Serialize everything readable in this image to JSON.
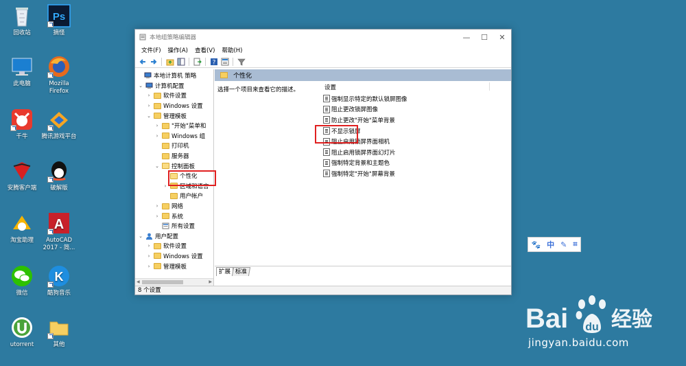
{
  "desktop": {
    "icons": [
      {
        "label": "回收站",
        "icon": "recycle-bin-icon"
      },
      {
        "label": "摘怪",
        "icon": "photoshop-icon"
      },
      {
        "label": "此电脑",
        "icon": "computer-icon"
      },
      {
        "label": "Mozilla Firefox",
        "icon": "firefox-icon"
      },
      {
        "label": "千牛",
        "icon": "qianniu-icon"
      },
      {
        "label": "腾讯游戏平台",
        "icon": "tencent-game-icon"
      },
      {
        "label": "安腾客户端",
        "icon": "antivirus-icon"
      },
      {
        "label": "破解版",
        "icon": "qq-icon"
      },
      {
        "label": "淘宝助理",
        "icon": "taobao-helper-icon"
      },
      {
        "label": "AutoCAD 2017 - 简...",
        "icon": "autocad-icon"
      },
      {
        "label": "微信",
        "icon": "wechat-icon"
      },
      {
        "label": "酷狗音乐",
        "icon": "kugou-icon"
      },
      {
        "label": "utorrent",
        "icon": "utorrent-icon"
      },
      {
        "label": "其他",
        "icon": "folder-icon"
      }
    ]
  },
  "window": {
    "title": "本地组策略编辑器",
    "menu": [
      "文件(F)",
      "操作(A)",
      "查看(V)",
      "帮助(H)"
    ],
    "tree": [
      {
        "label": "本地计算机 策略",
        "level": 0,
        "exp": "",
        "icon": "computer"
      },
      {
        "label": "计算机配置",
        "level": 1,
        "exp": "⌄",
        "icon": "computer"
      },
      {
        "label": "软件设置",
        "level": 2,
        "exp": "›",
        "icon": "folder"
      },
      {
        "label": "Windows 设置",
        "level": 2,
        "exp": "›",
        "icon": "folder"
      },
      {
        "label": "管理模板",
        "level": 2,
        "exp": "⌄",
        "icon": "folder"
      },
      {
        "label": "\"开始\"菜单和",
        "level": 3,
        "exp": "›",
        "icon": "folder"
      },
      {
        "label": "Windows 组",
        "level": 3,
        "exp": "›",
        "icon": "folder"
      },
      {
        "label": "打印机",
        "level": 3,
        "exp": "",
        "icon": "folder"
      },
      {
        "label": "服务器",
        "level": 3,
        "exp": "",
        "icon": "folder"
      },
      {
        "label": "控制面板",
        "level": 3,
        "exp": "⌄",
        "icon": "folder-open"
      },
      {
        "label": "个性化",
        "level": 4,
        "exp": "",
        "icon": "folder-open"
      },
      {
        "label": "区域和语言",
        "level": 4,
        "exp": "›",
        "icon": "folder"
      },
      {
        "label": "用户帐户",
        "level": 4,
        "exp": "",
        "icon": "folder"
      },
      {
        "label": "网络",
        "level": 3,
        "exp": "›",
        "icon": "folder"
      },
      {
        "label": "系统",
        "level": 3,
        "exp": "›",
        "icon": "folder"
      },
      {
        "label": "所有设置",
        "level": 3,
        "exp": "",
        "icon": "settings"
      },
      {
        "label": "用户配置",
        "level": 1,
        "exp": "⌄",
        "icon": "user"
      },
      {
        "label": "软件设置",
        "level": 2,
        "exp": "›",
        "icon": "folder"
      },
      {
        "label": "Windows 设置",
        "level": 2,
        "exp": "›",
        "icon": "folder"
      },
      {
        "label": "管理模板",
        "level": 2,
        "exp": "›",
        "icon": "folder"
      }
    ],
    "right_header": "个性化",
    "description": "选择一个项目来查看它的描述。",
    "settings_header": "设置",
    "settings": [
      "强制显示特定的默认锁屏图像",
      "阻止更改锁屏图像",
      "防止更改\"开始\"菜单背景",
      "不显示锁屏",
      "阻止启用锁屏界面相机",
      "阻止启用锁屏界面幻灯片",
      "强制特定背景和主题色",
      "强制特定\"开始\"屏幕背景"
    ],
    "tabs": [
      "扩展",
      "标准"
    ],
    "status": "8 个设置"
  },
  "baidu": {
    "tools": [
      "🐾",
      "中",
      "✎",
      "⌗"
    ],
    "logo_text": "Bai",
    "logo_cn": "经验",
    "url": "jingyan.baidu.com"
  },
  "colors": {
    "desktop": "#2d7aa0",
    "header": "#a9bcd3",
    "highlight": "#e02020"
  }
}
